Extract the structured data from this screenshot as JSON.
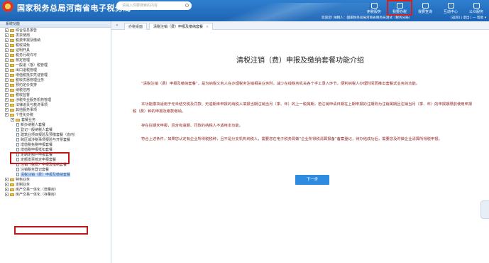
{
  "header": {
    "brand": "国家税务总局河南省电子税务局",
    "search_placeholder": "请输入你要搜索的内容",
    "nav": [
      {
        "label": "用税服务",
        "icon": "monitor-icon",
        "selected": false
      },
      {
        "label": "我要办税",
        "icon": "tax-handle-icon",
        "selected": true
      },
      {
        "label": "我要查询",
        "icon": "query-icon",
        "selected": false
      },
      {
        "label": "互动中心",
        "icon": "chat-icon",
        "selected": false
      },
      {
        "label": "公众服务",
        "icon": "public-icon",
        "selected": false
      }
    ],
    "welcome": "欢迎您!",
    "user_info": "纳税人：国家税务总局河南省税务局测试（税务分局）",
    "links": "[返回] | 退出 | 一 帮助 ▾"
  },
  "sidebar": {
    "title": "系统功能",
    "items": [
      {
        "label": "综合信息报告",
        "level": 0,
        "type": "folder"
      },
      {
        "label": "发票使用",
        "level": 0,
        "type": "folder"
      },
      {
        "label": "税费申报及缴纳",
        "level": 0,
        "type": "folder"
      },
      {
        "label": "税收减免",
        "level": 0,
        "type": "folder"
      },
      {
        "label": "证明开具",
        "level": 0,
        "type": "folder"
      },
      {
        "label": "税务行政许可",
        "level": 0,
        "type": "folder"
      },
      {
        "label": "核定管理",
        "level": 0,
        "type": "folder"
      },
      {
        "label": "一般退（抵）税管理",
        "level": 0,
        "type": "folder"
      },
      {
        "label": "出口退税管理",
        "level": 0,
        "type": "folder"
      },
      {
        "label": "增值税抵扣凭证管理",
        "level": 0,
        "type": "folder"
      },
      {
        "label": "税收优惠管理业务",
        "level": 0,
        "type": "folder"
      },
      {
        "label": "预约定价安排",
        "level": 0,
        "type": "folder"
      },
      {
        "label": "纳税信用",
        "level": 0,
        "type": "folder"
      },
      {
        "label": "税收监督",
        "level": 0,
        "type": "folder"
      },
      {
        "label": "涉税专业服务机构管理",
        "level": 0,
        "type": "folder"
      },
      {
        "label": "法律追责与救济事项",
        "level": 0,
        "type": "folder"
      },
      {
        "label": "其他服务事项",
        "level": 0,
        "type": "folder"
      },
      {
        "label": "个性化办税",
        "level": 0,
        "type": "folder"
      },
      {
        "label": "套餐业务",
        "level": 1,
        "type": "folder"
      },
      {
        "label": "新办纳税人套餐",
        "level": 2,
        "type": "doc"
      },
      {
        "label": "登记一般纳税人套餐",
        "level": 2,
        "type": "doc"
      },
      {
        "label": "建筑业项目报验及预缴套餐（省内）",
        "level": 2,
        "type": "doc"
      },
      {
        "label": "跨区域涉税事项报验与开票套餐",
        "level": 2,
        "type": "doc"
      },
      {
        "label": "增值税免税申报套餐",
        "level": 2,
        "type": "doc"
      },
      {
        "label": "增值税申报抵扣套餐",
        "level": 2,
        "type": "doc"
      },
      {
        "label": "定期定额户申报套餐",
        "level": 2,
        "type": "doc"
      },
      {
        "label": "定额发票核定申报套餐",
        "level": 2,
        "type": "doc"
      },
      {
        "label": "注销（税费）申报及缴纳套餐",
        "level": 2,
        "type": "doc"
      },
      {
        "label": "注销税务登记套餐",
        "level": 2,
        "type": "doc"
      },
      {
        "label": "清税注销（费）申报及缴纳套餐",
        "level": 2,
        "type": "doc",
        "selected": true
      },
      {
        "label": "特色业务",
        "level": 0,
        "type": "folder"
      },
      {
        "label": "定制业务",
        "level": 0,
        "type": "folder"
      },
      {
        "label": "房产交易一体化（增量房）",
        "level": 0,
        "type": "folder"
      },
      {
        "label": "房产交易一体化（存量房）",
        "level": 0,
        "type": "folder"
      }
    ]
  },
  "tabs": [
    {
      "label": "办税桌面",
      "active": false
    },
    {
      "label": "清税注销（费）申报及缴纳套餐",
      "active": true
    }
  ],
  "main": {
    "title": "清税注销（费）申报及缴纳套餐功能介绍",
    "paragraphs": [
      "“清税注销（费）申报及缴纳套餐”，是为纳税义务人在办理税务注销相关业务时，减少在线税务机关各个手工录入环节，便利纳税人办理时间而推出套餐式业务的功能。",
      "本功能模块适用于无未结交税及罚款、无逾期未申报的纳税人填报当期注销当月（季、年）的上一税属期，若注销申请日期在上期申报的注期则为注销属期且注销当月（季、年）的申报期限前使用申报税（费）种的申报及缴款缴纳。",
      "存在往期未申报，且含有逾期、罚款的纳税人不适用本功能。",
      "符合上述条件，如果您认定有企业所得税税种，且不是分支机构纳税人，需要您在电子税务局做“企业所得税清算报备”备案登记，待办结成功后，需要您及时做企业清算所得税申报。"
    ],
    "next_label": "下一步"
  }
}
